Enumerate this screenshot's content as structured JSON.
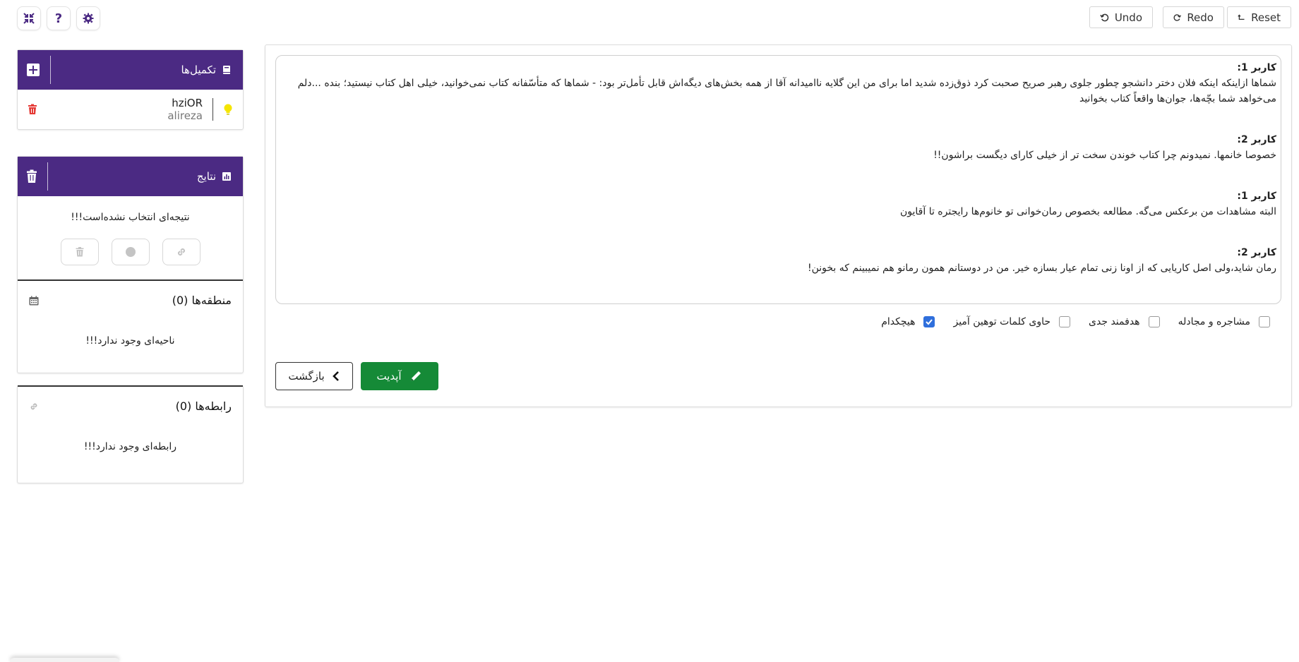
{
  "toolbar": {
    "undo_label": "Undo",
    "redo_label": "Redo",
    "reset_label": "Reset",
    "left_icons": [
      "compress-icon",
      "help-icon",
      "settings-icon"
    ]
  },
  "extensions": {
    "title": "تکمیل‌ها",
    "items": [
      {
        "name": "hziOR",
        "user": "alireza"
      }
    ]
  },
  "results": {
    "title": "نتایج",
    "empty_message": "نتیجه‌ای انتخاب نشده‌است!!!",
    "regions": {
      "title": "منطقه‌ها (0)",
      "empty": "ناحیه‌ای وجود ندارد!!!"
    },
    "relations": {
      "title": "رابطه‌ها (0)",
      "empty": "رابطه‌ای وجود ندارد!!!"
    }
  },
  "conversation": [
    {
      "speaker": "کاربر 1:",
      "text": "شماها ازاینکه اینکه فلان دختر دانشجو چطور جلوی رهبر صریح صحبت کرد ذوق‌زده شدید اما برای من این گلایه ناامیدانه آقا از همه بخش‌های دیگه‌اش قابل تأمل‌تر بود: - شماها که متأسّفانه کتاب نمی‌خوانید، خیلی اهل کتاب نیستید؛ بنده ...دلم می‌خواهد شما بچّه‌ها، جوان‌ها واقعاً کتاب بخوانید"
    },
    {
      "speaker": "کاربر 2:",
      "text": "خصوصا خانمها. نمیدونم چرا کتاب خوندن سخت تر از خیلی کارای دیگست براشون!!"
    },
    {
      "speaker": "کاربر 1:",
      "text": "البته مشاهدات من برعکس می‌گه. مطالعه بخصوص رمان‌خوانی تو خانوم‌ها رایجتره تا آقایون"
    },
    {
      "speaker": "کاربر 2:",
      "text": "رمان شاید،ولی اصل کاریایی که از اونا زنی تمام عیار بسازه خیر. من در دوستانم همون رمانو هم نمیبینم که بخونن!"
    }
  ],
  "options": [
    {
      "label": "مشاجره و مجادله",
      "checked": false
    },
    {
      "label": "هدفمند جدی",
      "checked": false
    },
    {
      "label": "حاوی کلمات توهین آمیز",
      "checked": false
    },
    {
      "label": "هیچکدام",
      "checked": true
    }
  ],
  "actions": {
    "back_label": "بازگشت",
    "update_label": "آپدیت"
  },
  "colors": {
    "header_purple": "#4b2a83",
    "update_green": "#158a37",
    "delete_red": "#e53935",
    "bulb_yellow": "#f5e500",
    "checkbox_blue": "#2f6fdc"
  }
}
